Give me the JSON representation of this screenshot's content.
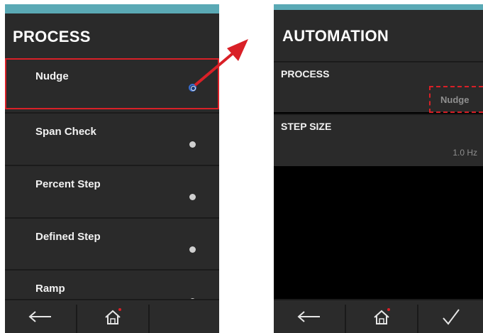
{
  "left_screen": {
    "title": "PROCESS",
    "items": [
      {
        "label": "Nudge",
        "selected": true
      },
      {
        "label": "Span Check",
        "selected": false
      },
      {
        "label": "Percent Step",
        "selected": false
      },
      {
        "label": "Defined Step",
        "selected": false
      },
      {
        "label": "Ramp",
        "selected": false
      }
    ],
    "nav": [
      "back-arrow-icon",
      "home-icon"
    ]
  },
  "right_screen": {
    "title": "AUTOMATION",
    "sections": [
      {
        "label": "PROCESS",
        "value": "Nudge"
      },
      {
        "label": "STEP SIZE",
        "value": "1.0 Hz"
      }
    ],
    "nav": [
      "back-arrow-icon",
      "home-icon",
      "checkmark-icon"
    ]
  },
  "colors": {
    "accent": "#5aa9b5",
    "highlight": "#d92027",
    "background": "#2a2a2a"
  }
}
